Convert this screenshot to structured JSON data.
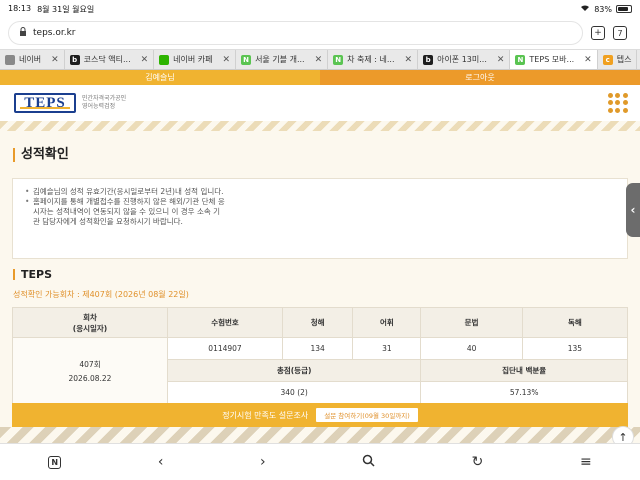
{
  "status_bar": {
    "time": "18:13",
    "date": "8월 31일 월요일",
    "battery": "83%",
    "battery_level": 0.83
  },
  "browser": {
    "url": "teps.or.kr",
    "tab_count": "7",
    "tabs": [
      {
        "label": "네이버",
        "favicon": "home-icon",
        "color": "#888888"
      },
      {
        "label": "코스닥 액티...",
        "favicon": "b-icon",
        "color": "#1e1e1e"
      },
      {
        "label": "네이버 카페",
        "favicon": "leaf-icon",
        "color": "#2db400"
      },
      {
        "label": "서울 기블 개...",
        "favicon": "n-icon",
        "color": "#5ac451"
      },
      {
        "label": "차 축제 : 네...",
        "favicon": "n-icon",
        "color": "#5ac451"
      },
      {
        "label": "아이폰 13미...",
        "favicon": "b-icon",
        "color": "#1e1e1e"
      },
      {
        "label": "TEPS 모바...",
        "favicon": "n-icon",
        "color": "#5ac451",
        "active": true
      },
      {
        "label": "텝스",
        "favicon": "c-icon",
        "color": "#f0a020"
      }
    ]
  },
  "login": {
    "user": "김예슬님",
    "logout": "로그아웃"
  },
  "header": {
    "logo": "TEPS",
    "logo_sub_line1": "민간자격국가공인",
    "logo_sub_line2": "영어능력검정"
  },
  "page": {
    "title": "성적확인",
    "notices": [
      "김예슬님의 성적 유효기간(응시일로부터 2년)내 성적 입니다.",
      "홈페이지를 통해 개별접수를 진행하지 않은 해외/기관 단체 응시자는 성적내역이 연동되지 않을 수 있으니 이 경우 소속 기관 담당자에게 성적확인을 요청하시기 바랍니다."
    ],
    "section": "TEPS",
    "period": "성적확인 가능회차 : 제407회 (2026년 08월 22일)"
  },
  "score_table": {
    "headers": {
      "round": "회차\n(응시일자)",
      "exam_no": "수험번호",
      "listening": "청해",
      "vocab": "어휘",
      "grammar": "문법",
      "reading": "독해",
      "total": "총점(등급)",
      "percentile": "집단내 백분율"
    },
    "round_no": "407회",
    "round_date": "2026.08.22",
    "exam_no": "0114907",
    "listening": "134",
    "vocab": "31",
    "grammar": "40",
    "reading": "135",
    "total": "340 (2)",
    "percentile": "57.13%"
  },
  "survey": {
    "text": "정기시험 만족도 설문조사",
    "button": "설문 참여하기(09월 30일까지)"
  },
  "colors": {
    "accent": "#f0b330",
    "accent_dark": "#ec9a2a",
    "brand": "#1b3f8f",
    "background": "#fcf8ee"
  }
}
